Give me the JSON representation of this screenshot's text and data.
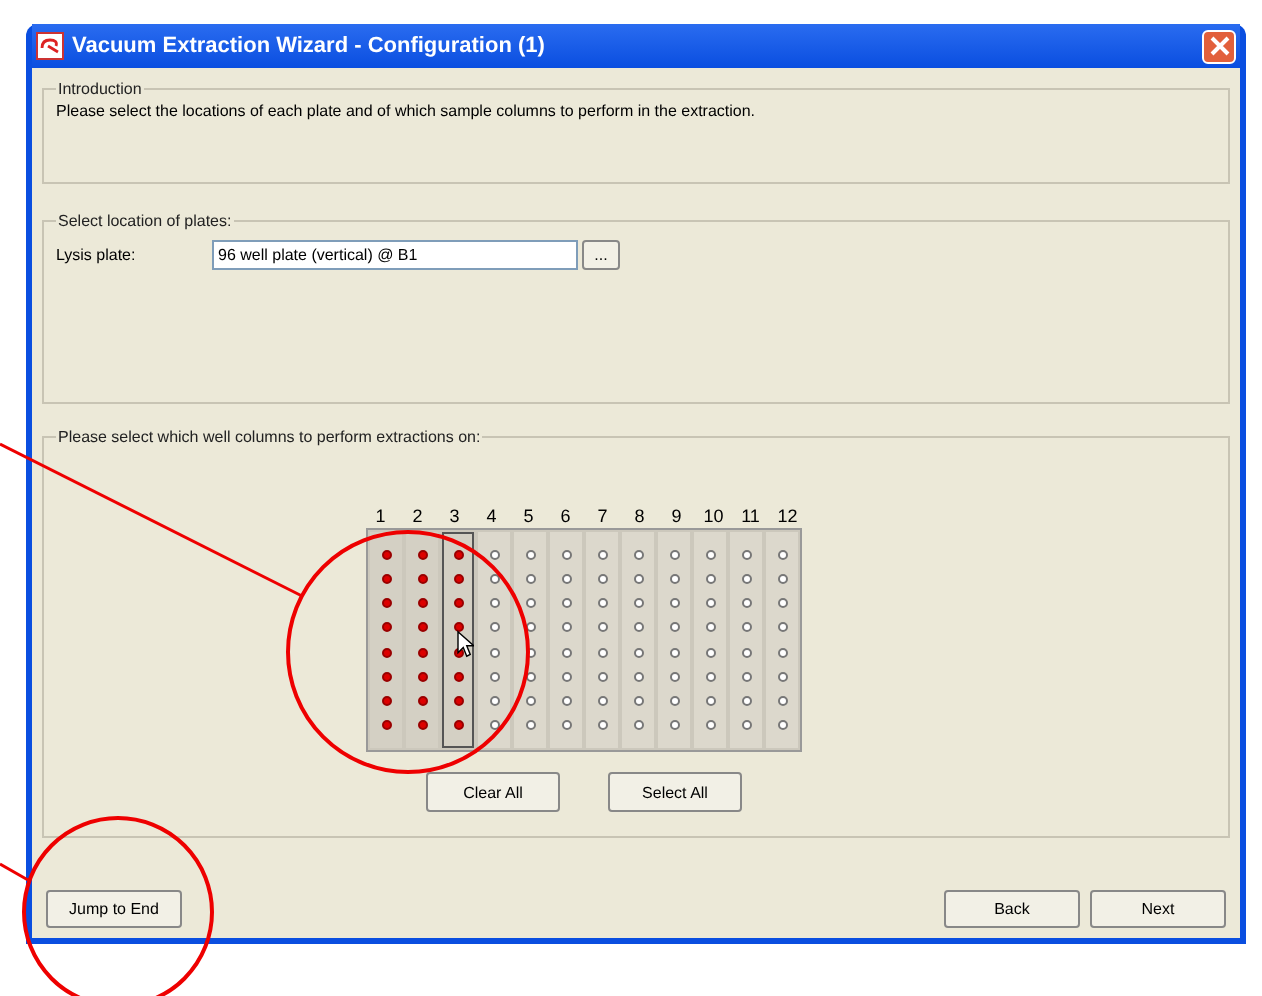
{
  "window": {
    "title": "Vacuum Extraction Wizard - Configuration (1)"
  },
  "introduction": {
    "legend": "Introduction",
    "text": "Please select the locations of each plate and of which sample columns to perform in the extraction."
  },
  "plates": {
    "legend": "Select location of plates:",
    "label": "Lysis plate:",
    "value": "96 well plate (vertical) @ B1",
    "browse": "..."
  },
  "columns_group": {
    "legend": "Please select which well columns to perform extractions on:",
    "columns": [
      {
        "label": "1",
        "selected": true,
        "focused": false
      },
      {
        "label": "2",
        "selected": true,
        "focused": false
      },
      {
        "label": "3",
        "selected": true,
        "focused": true
      },
      {
        "label": "4",
        "selected": false,
        "focused": false
      },
      {
        "label": "5",
        "selected": false,
        "focused": false
      },
      {
        "label": "6",
        "selected": false,
        "focused": false
      },
      {
        "label": "7",
        "selected": false,
        "focused": false
      },
      {
        "label": "8",
        "selected": false,
        "focused": false
      },
      {
        "label": "9",
        "selected": false,
        "focused": false
      },
      {
        "label": "10",
        "selected": false,
        "focused": false
      },
      {
        "label": "11",
        "selected": false,
        "focused": false
      },
      {
        "label": "12",
        "selected": false,
        "focused": false
      }
    ],
    "buttons": [
      "Clear All",
      "Select All"
    ]
  },
  "footer": {
    "jump": "Jump to End",
    "back": "Back",
    "next": "Next"
  }
}
